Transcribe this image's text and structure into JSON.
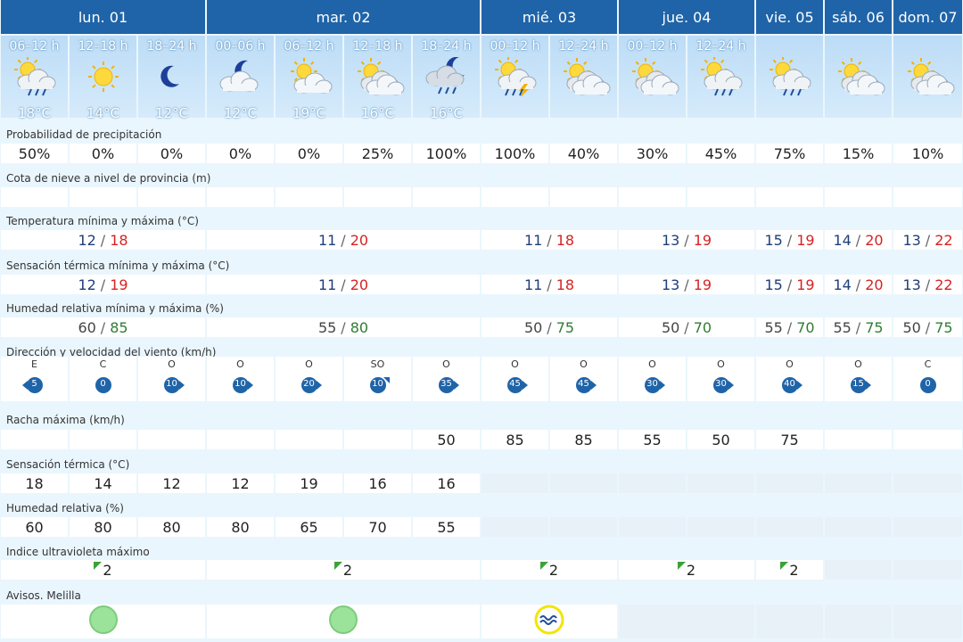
{
  "days": [
    "lun. 01",
    "mar. 02",
    "mié. 03",
    "jue. 04",
    "vie. 05",
    "sáb. 06",
    "dom. 07"
  ],
  "periods": [
    {
      "label": "06–12 h",
      "icon": "sun-cloud-rain-icon",
      "temp": "18°C"
    },
    {
      "label": "12–18 h",
      "icon": "sun-icon",
      "temp": "14°C"
    },
    {
      "label": "18–24 h",
      "icon": "moon-icon",
      "temp": "12°C"
    },
    {
      "label": "00–06 h",
      "icon": "moon-cloud-icon",
      "temp": "12°C"
    },
    {
      "label": "06–12 h",
      "icon": "sun-cloud-icon",
      "temp": "19°C"
    },
    {
      "label": "12–18 h",
      "icon": "sun-clouds-icon",
      "temp": "16°C"
    },
    {
      "label": "18–24 h",
      "icon": "moon-cloud-rain-icon",
      "temp": "16°C"
    },
    {
      "label": "00–12 h",
      "icon": "sun-cloud-storm-icon",
      "temp": ""
    },
    {
      "label": "12–24 h",
      "icon": "sun-clouds-icon",
      "temp": ""
    },
    {
      "label": "00–12 h",
      "icon": "sun-clouds-icon",
      "temp": ""
    },
    {
      "label": "12–24 h",
      "icon": "sun-cloud-rain-icon",
      "temp": ""
    },
    {
      "label": "",
      "icon": "sun-cloud-rain-icon",
      "temp": ""
    },
    {
      "label": "",
      "icon": "sun-clouds-icon",
      "temp": ""
    },
    {
      "label": "",
      "icon": "sun-clouds-icon",
      "temp": ""
    }
  ],
  "labels": {
    "precip": "Probabilidad de precipitación",
    "snow": "Cota de nieve a nivel de provincia (m)",
    "temp": "Temperatura mínima y máxima (°C)",
    "feel": "Sensación térmica mínima y máxima (°C)",
    "hum": "Humedad relativa mínima y máxima (%)",
    "wind": "Dirección y velocidad del viento (km/h)",
    "gust": "Racha máxima (km/h)",
    "feel2": "Sensación térmica (°C)",
    "hum2": "Humedad relativa (%)",
    "uv": "Indice ultravioleta máximo",
    "alert": "Avisos. Melilla"
  },
  "precip": [
    "50%",
    "0%",
    "0%",
    "0%",
    "0%",
    "25%",
    "100%",
    "100%",
    "40%",
    "30%",
    "45%",
    "75%",
    "15%",
    "10%"
  ],
  "temp_minmax": [
    {
      "min": "12",
      "max": "18"
    },
    {
      "min": "11",
      "max": "20"
    },
    {
      "min": "11",
      "max": "18"
    },
    {
      "min": "13",
      "max": "19"
    },
    {
      "min": "15",
      "max": "19"
    },
    {
      "min": "14",
      "max": "20"
    },
    {
      "min": "13",
      "max": "22"
    }
  ],
  "feel_minmax": [
    {
      "min": "12",
      "max": "19"
    },
    {
      "min": "11",
      "max": "20"
    },
    {
      "min": "11",
      "max": "18"
    },
    {
      "min": "13",
      "max": "19"
    },
    {
      "min": "15",
      "max": "19"
    },
    {
      "min": "14",
      "max": "20"
    },
    {
      "min": "13",
      "max": "22"
    }
  ],
  "hum_minmax": [
    {
      "min": "60",
      "max": "85"
    },
    {
      "min": "55",
      "max": "80"
    },
    {
      "min": "50",
      "max": "75"
    },
    {
      "min": "50",
      "max": "70"
    },
    {
      "min": "55",
      "max": "70"
    },
    {
      "min": "55",
      "max": "75"
    },
    {
      "min": "50",
      "max": "75"
    }
  ],
  "wind": [
    {
      "dir": "E",
      "speed": "5"
    },
    {
      "dir": "C",
      "speed": "0"
    },
    {
      "dir": "O",
      "speed": "10"
    },
    {
      "dir": "O",
      "speed": "10"
    },
    {
      "dir": "O",
      "speed": "20"
    },
    {
      "dir": "SO",
      "speed": "10"
    },
    {
      "dir": "O",
      "speed": "35"
    },
    {
      "dir": "O",
      "speed": "45"
    },
    {
      "dir": "O",
      "speed": "45"
    },
    {
      "dir": "O",
      "speed": "30"
    },
    {
      "dir": "O",
      "speed": "30"
    },
    {
      "dir": "O",
      "speed": "40"
    },
    {
      "dir": "O",
      "speed": "15"
    },
    {
      "dir": "C",
      "speed": "0"
    }
  ],
  "gust": [
    "",
    "",
    "",
    "",
    "",
    "",
    "50",
    "85",
    "85",
    "55",
    "50",
    "75",
    "",
    ""
  ],
  "feel2": [
    "18",
    "14",
    "12",
    "12",
    "19",
    "16",
    "16"
  ],
  "hum2": [
    "60",
    "80",
    "80",
    "80",
    "65",
    "70",
    "55"
  ],
  "uv": [
    "2",
    "2",
    "2",
    "2",
    "2"
  ],
  "alerts": [
    "green-alert-icon",
    "green-alert-icon",
    "yellow-coastal-alert-icon"
  ],
  "colors": {
    "header": "#1f64a8",
    "min": "#1d3f7a",
    "max": "#d72323",
    "humidity_max": "#2e7d32",
    "wind": "#1f64a8",
    "alert_green": "#9be29b",
    "alert_yellow": "#f2e600"
  }
}
